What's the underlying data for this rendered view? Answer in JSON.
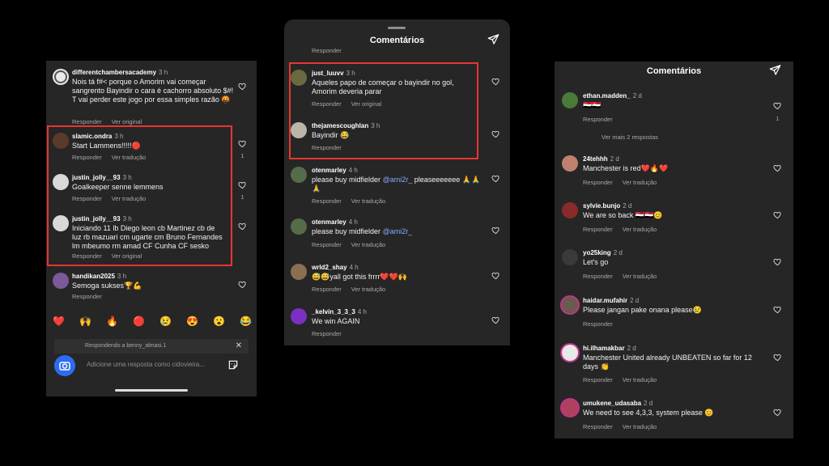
{
  "panel_left": {
    "comments": [
      {
        "username": "differentchambersacademy",
        "time": "3 h",
        "text": "Nois tá f#< porque o Amorim vai começar sangrento Bayindir o cara é cachorro absoluto $#! T vai perder este jogo por essa simples razão 🤬",
        "reply": "Responder",
        "translate": "Ver original",
        "likes": ""
      },
      {
        "username": "slamic.ondra",
        "time": "3 h",
        "text": "Start Lammens!!!!!🔴",
        "reply": "Responder",
        "translate": "Ver tradução",
        "likes": "1"
      },
      {
        "username": "justin_jolly__93",
        "time": "3 h",
        "text": "Goalkeeper senne lemmens",
        "reply": "Responder",
        "translate": "Ver tradução",
        "likes": "1"
      },
      {
        "username": "justin_jolly__93",
        "time": "3 h",
        "text": "Iniciando 11 lb Diego leon cb Martinez cb de luz rb mazuari cm ugarte cm Bruno Fernandes lm mbeumo rm amad CF Cunha CF sesko",
        "reply": "Responder",
        "translate": "Ver original",
        "likes": ""
      },
      {
        "username": "handikan2025",
        "time": "3 h",
        "text": "Semoga sukses🏆💪",
        "reply": "Responder",
        "translate": "",
        "likes": ""
      }
    ],
    "emojis": [
      "❤️",
      "🙌",
      "🔥",
      "🔴",
      "😢",
      "😍",
      "😮",
      "😂"
    ],
    "replying_to": "Respondendo a benny_almasi.1",
    "close_symbol": "✕",
    "reply_placeholder": "Adicione uma resposta como cidovieira..."
  },
  "panel_middle": {
    "title": "Comentários",
    "top_reply": "Responder",
    "comments": [
      {
        "username": "just_luuvv",
        "time": "3 h",
        "text": "Aqueles papo de começar o bayindir no gol, Amorim deveria parar",
        "reply": "Responder",
        "translate": "Ver original"
      },
      {
        "username": "thejamescoughlan",
        "time": "3 h",
        "text": "Bayindir 😂",
        "reply": "Responder",
        "translate": ""
      },
      {
        "username": "otenmarley",
        "time": "4 h",
        "mention": "@ami2r_",
        "text": " pleaseeeeeee 🙏🙏🙏",
        "pre": "please buy midfielder ",
        "reply": "Responder",
        "translate": "Ver tradução"
      },
      {
        "username": "otenmarley",
        "time": "4 h",
        "mention": "@ami2r_",
        "text": "",
        "pre": "please buy midfielder ",
        "reply": "Responder",
        "translate": "Ver tradução"
      },
      {
        "username": "wrld2_shay",
        "time": "4 h",
        "text": "😅😅yall got this frrrr❤️❤️🙌",
        "reply": "Responder",
        "translate": "Ver tradução"
      },
      {
        "username": "_kelvin_3_3_3",
        "time": "4 h",
        "text": "We win AGAIN",
        "reply": "Responder",
        "translate": ""
      }
    ]
  },
  "panel_right": {
    "title": "Comentários",
    "view_more": "Ver mais 2 respostas",
    "comments": [
      {
        "username": "ethan.madden_",
        "time": "2 d",
        "text": "🇾🇪🇾🇪",
        "reply": "Responder",
        "translate": "",
        "likes": "1"
      },
      {
        "username": "24tehhh",
        "time": "2 d",
        "text": "Manchester is red❤️🔥❤️",
        "reply": "Responder",
        "translate": "Ver tradução"
      },
      {
        "username": "sylvie.bunjo",
        "time": "2 d",
        "text": "We are so back 🇾🇪🇾🇪😊",
        "reply": "Responder",
        "translate": "Ver tradução"
      },
      {
        "username": "yo25king",
        "time": "2 d",
        "text": "Let's go",
        "reply": "Responder",
        "translate": "Ver tradução"
      },
      {
        "username": "haidar.mufahir",
        "time": "2 d",
        "text": "Please jangan pake onana please😢",
        "reply": "Responder",
        "translate": ""
      },
      {
        "username": "hi.ilhamakbar",
        "time": "2 d",
        "text": "Manchester United already UNBEATEN so far for 12 days 👏",
        "reply": "Responder",
        "translate": "Ver tradução"
      },
      {
        "username": "umukene_udasaba",
        "time": "2 d",
        "text": "We need to see 4,3,3, system please 😊",
        "reply": "Responder",
        "translate": "Ver tradução"
      }
    ]
  },
  "colors": {
    "background": "#000000",
    "panel": "#262626",
    "highlight": "#e8362f",
    "muted": "#a8a8a8",
    "accent": "#2d6cf0"
  }
}
